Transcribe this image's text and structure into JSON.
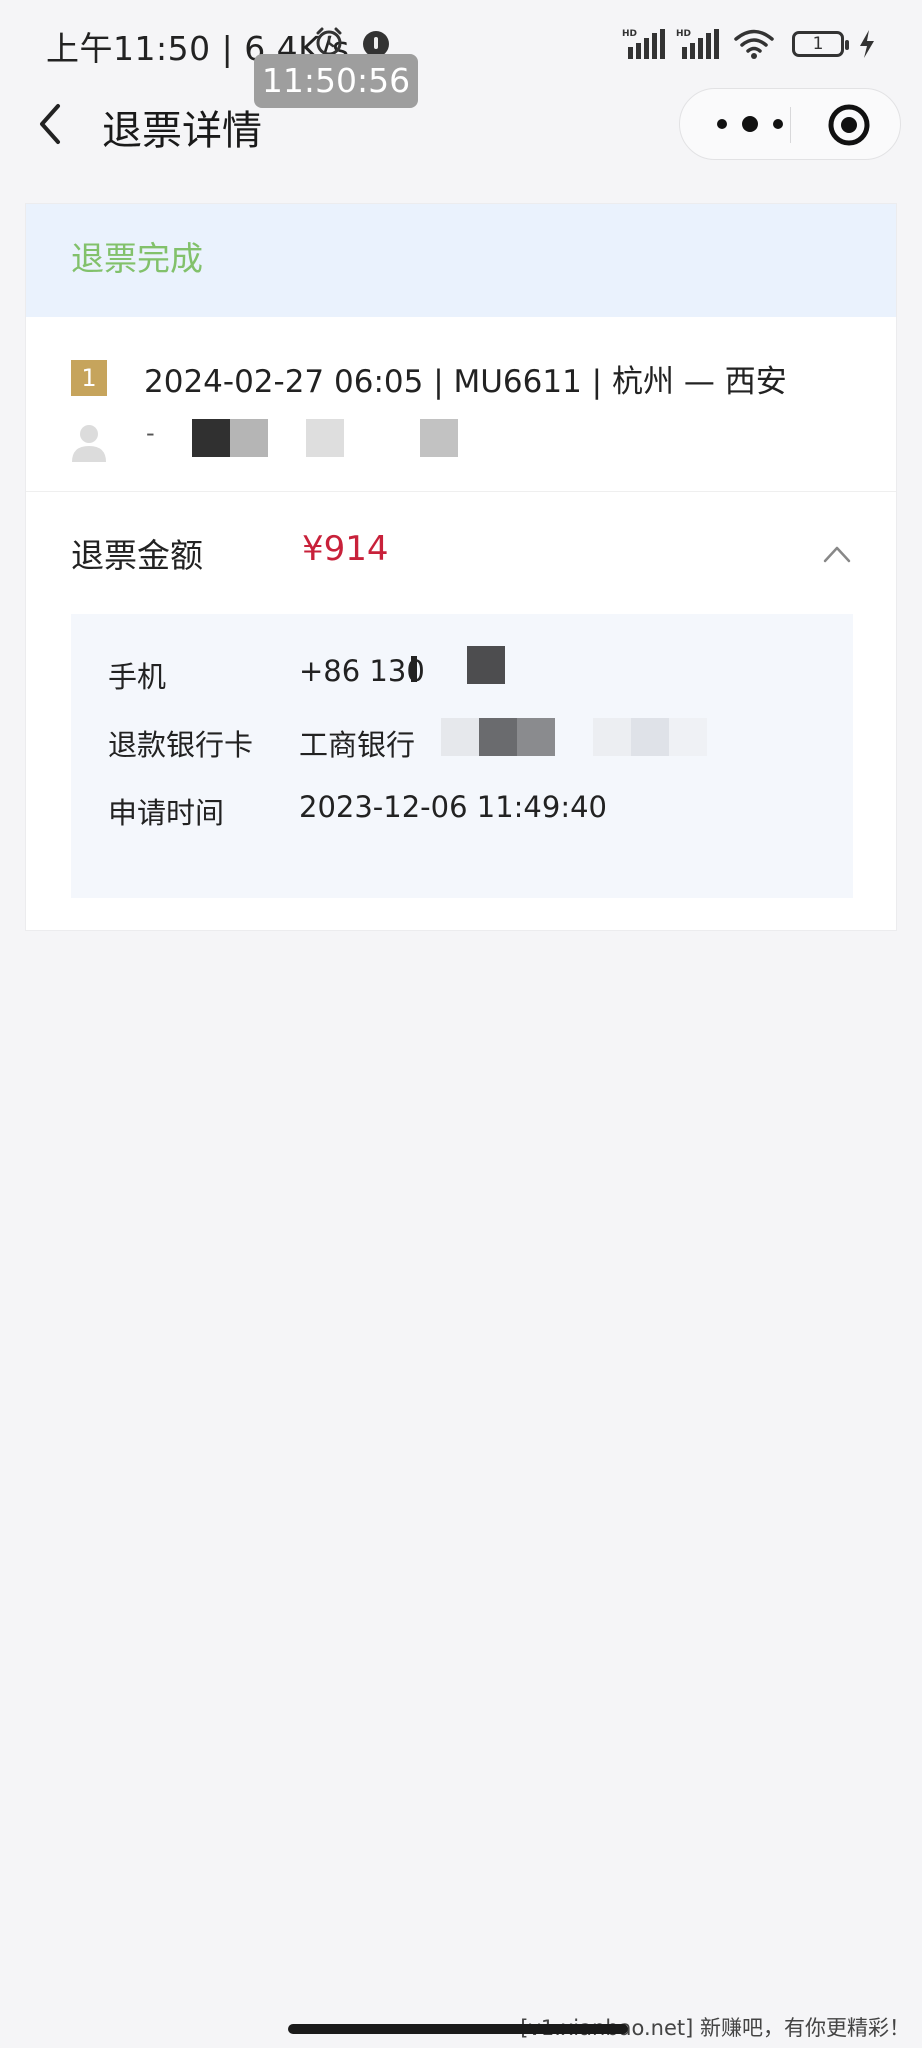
{
  "status_bar": {
    "left_text": "上午11:50 | 6.4K/s",
    "time_overlay": "11:50:56",
    "battery_level": "1",
    "icons": [
      "alarm-icon",
      "app-notification-icon",
      "signal-hd-icon",
      "signal-hd-icon",
      "wifi-icon",
      "battery-icon",
      "charging-icon"
    ]
  },
  "nav": {
    "title": "退票详情",
    "back_icon": "chevron-left-icon",
    "more_icon": "more-dots-icon",
    "close_icon": "target-close-icon"
  },
  "refund": {
    "status": "退票完成",
    "status_color": "#82c16b",
    "flight_index": "1",
    "flight_info": "2024-02-27 06:05 | MU6611 | 杭州 — 西安",
    "passenger_icon": "person-icon",
    "passenger_prefix": "-",
    "amount_label": "退票金额",
    "amount": "¥914",
    "amount_color": "#c8213a",
    "collapse_icon": "chevron-up-icon",
    "details": [
      {
        "label": "手机",
        "value": "+86 130"
      },
      {
        "label": "退款银行卡",
        "value": "工商银行"
      },
      {
        "label": "申请时间",
        "value": "2023-12-06 11:49:40"
      }
    ]
  },
  "footer": {
    "watermark": "[v1.xianbao.net] 新赚吧，有你更精彩！"
  },
  "colors": {
    "badge": "#c6a45c",
    "banner_bg": "#eaf2fd",
    "detail_bg": "#f4f7fc"
  }
}
